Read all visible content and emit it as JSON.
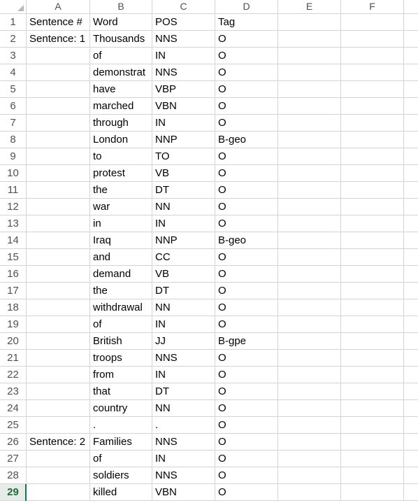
{
  "columns": [
    "A",
    "B",
    "C",
    "D",
    "E",
    "F"
  ],
  "rows": [
    {
      "num": "1",
      "a": "Sentence #",
      "b": "Word",
      "c": "POS",
      "d": "Tag"
    },
    {
      "num": "2",
      "a": "Sentence: 1",
      "b": "Thousands",
      "c": "NNS",
      "d": "O"
    },
    {
      "num": "3",
      "a": "",
      "b": "of",
      "c": "IN",
      "d": "O"
    },
    {
      "num": "4",
      "a": "",
      "b": "demonstrat",
      "c": "NNS",
      "d": "O"
    },
    {
      "num": "5",
      "a": "",
      "b": "have",
      "c": "VBP",
      "d": "O"
    },
    {
      "num": "6",
      "a": "",
      "b": "marched",
      "c": "VBN",
      "d": "O"
    },
    {
      "num": "7",
      "a": "",
      "b": "through",
      "c": "IN",
      "d": "O"
    },
    {
      "num": "8",
      "a": "",
      "b": "London",
      "c": "NNP",
      "d": "B-geo"
    },
    {
      "num": "9",
      "a": "",
      "b": "to",
      "c": "TO",
      "d": "O"
    },
    {
      "num": "10",
      "a": "",
      "b": "protest",
      "c": "VB",
      "d": "O"
    },
    {
      "num": "11",
      "a": "",
      "b": "the",
      "c": "DT",
      "d": "O"
    },
    {
      "num": "12",
      "a": "",
      "b": "war",
      "c": "NN",
      "d": "O"
    },
    {
      "num": "13",
      "a": "",
      "b": "in",
      "c": "IN",
      "d": "O"
    },
    {
      "num": "14",
      "a": "",
      "b": "Iraq",
      "c": "NNP",
      "d": "B-geo"
    },
    {
      "num": "15",
      "a": "",
      "b": "and",
      "c": "CC",
      "d": "O"
    },
    {
      "num": "16",
      "a": "",
      "b": "demand",
      "c": "VB",
      "d": "O"
    },
    {
      "num": "17",
      "a": "",
      "b": "the",
      "c": "DT",
      "d": "O"
    },
    {
      "num": "18",
      "a": "",
      "b": "withdrawal",
      "c": "NN",
      "d": "O"
    },
    {
      "num": "19",
      "a": "",
      "b": "of",
      "c": "IN",
      "d": "O"
    },
    {
      "num": "20",
      "a": "",
      "b": "British",
      "c": "JJ",
      "d": "B-gpe"
    },
    {
      "num": "21",
      "a": "",
      "b": "troops",
      "c": "NNS",
      "d": "O"
    },
    {
      "num": "22",
      "a": "",
      "b": "from",
      "c": "IN",
      "d": "O"
    },
    {
      "num": "23",
      "a": "",
      "b": "that",
      "c": "DT",
      "d": "O"
    },
    {
      "num": "24",
      "a": "",
      "b": "country",
      "c": "NN",
      "d": "O"
    },
    {
      "num": "25",
      "a": "",
      "b": ".",
      "c": ".",
      "d": "O"
    },
    {
      "num": "26",
      "a": "Sentence: 2",
      "b": "Families",
      "c": "NNS",
      "d": "O"
    },
    {
      "num": "27",
      "a": "",
      "b": "of",
      "c": "IN",
      "d": "O"
    },
    {
      "num": "28",
      "a": "",
      "b": "soldiers",
      "c": "NNS",
      "d": "O"
    },
    {
      "num": "29",
      "a": "",
      "b": "killed",
      "c": "VBN",
      "d": "O"
    }
  ],
  "active_row": "29",
  "colors": {
    "grid": "#d4d4d4",
    "header_text": "#505050",
    "active_row_accent": "#107c41"
  }
}
